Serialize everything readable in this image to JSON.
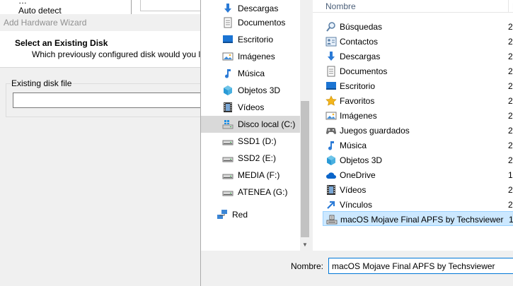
{
  "wizard": {
    "top_list_item_upper": "…",
    "top_list_item": "Auto detect",
    "window_title": "Add Hardware Wizard",
    "header_title": "Select an Existing Disk",
    "header_subtitle": "Which previously configured disk would you like to",
    "group_label": "Existing disk file",
    "disk_file_value": ""
  },
  "dialog": {
    "nav": [
      {
        "label": "Descargas",
        "icon": "download-arrow-icon"
      },
      {
        "label": "Documentos",
        "icon": "documents-icon"
      },
      {
        "label": "Escritorio",
        "icon": "desktop-icon"
      },
      {
        "label": "Imágenes",
        "icon": "pictures-icon"
      },
      {
        "label": "Música",
        "icon": "music-note-icon"
      },
      {
        "label": "Objetos 3D",
        "icon": "cube-3d-icon"
      },
      {
        "label": "Vídeos",
        "icon": "film-icon"
      },
      {
        "label": "Disco local (C:)",
        "icon": "windows-drive-icon"
      },
      {
        "label": "SSD1 (D:)",
        "icon": "drive-icon"
      },
      {
        "label": "SSD2 (E:)",
        "icon": "drive-icon"
      },
      {
        "label": "MEDIA (F:)",
        "icon": "drive-icon"
      },
      {
        "label": "ATENEA (G:)",
        "icon": "drive-icon"
      },
      {
        "label": "Red",
        "icon": "network-icon"
      }
    ],
    "column_name": "Nombre",
    "column_date": "F",
    "files": [
      {
        "label": "Búsquedas",
        "icon": "search-folder-icon",
        "date": "2"
      },
      {
        "label": "Contactos",
        "icon": "contacts-icon",
        "date": "2"
      },
      {
        "label": "Descargas",
        "icon": "download-arrow-icon",
        "date": "2"
      },
      {
        "label": "Documentos",
        "icon": "documents-icon",
        "date": "2"
      },
      {
        "label": "Escritorio",
        "icon": "desktop-icon",
        "date": "2"
      },
      {
        "label": "Favoritos",
        "icon": "star-icon",
        "date": "2"
      },
      {
        "label": "Imágenes",
        "icon": "pictures-icon",
        "date": "2"
      },
      {
        "label": "Juegos guardados",
        "icon": "saved-games-icon",
        "date": "2"
      },
      {
        "label": "Música",
        "icon": "music-note-icon",
        "date": "2"
      },
      {
        "label": "Objetos 3D",
        "icon": "cube-3d-icon",
        "date": "2"
      },
      {
        "label": "OneDrive",
        "icon": "cloud-icon",
        "date": "1"
      },
      {
        "label": "Vídeos",
        "icon": "film-icon",
        "date": "2"
      },
      {
        "label": "Vínculos",
        "icon": "link-arrow-icon",
        "date": "2"
      },
      {
        "label": "macOS Mojave Final APFS by Techsviewer",
        "icon": "disk-image-icon",
        "date": "1"
      }
    ],
    "filename_label": "Nombre:",
    "filename_value": "macOS Mojave Final APFS by Techsviewer"
  },
  "colors": {
    "accent": "#0078d7",
    "selection": "#cce8ff",
    "nav_selected": "#d9d9d9",
    "header_text": "#4c607a"
  }
}
